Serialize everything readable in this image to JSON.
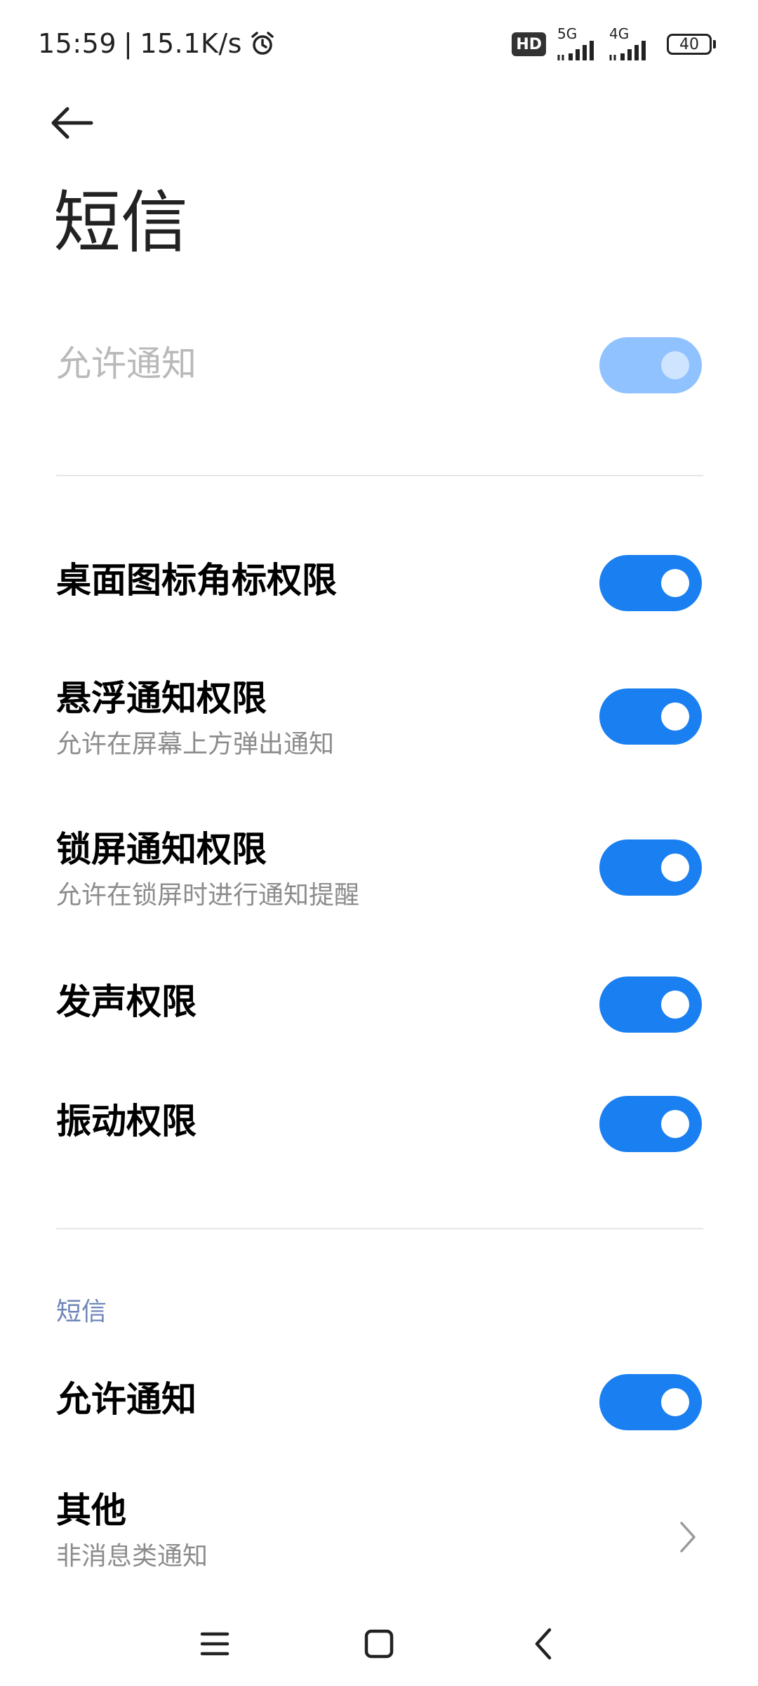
{
  "status_bar": {
    "time": "15:59",
    "separator": "|",
    "speed": "15.1K/s",
    "hd_label": "HD",
    "net1_label": "5G",
    "net2_label": "4G",
    "battery": "40",
    "icons": [
      "alarm-icon",
      "signal-5g-icon",
      "signal-4g-icon",
      "battery-icon"
    ]
  },
  "header": {
    "back_icon": "back-arrow-icon",
    "title": "短信"
  },
  "settings": {
    "allow_notifications_master": {
      "label": "允许通知",
      "enabled": false,
      "on": true
    },
    "items": [
      {
        "title": "桌面图标角标权限",
        "subtitle": "",
        "on": true
      },
      {
        "title": "悬浮通知权限",
        "subtitle": "允许在屏幕上方弹出通知",
        "on": true
      },
      {
        "title": "锁屏通知权限",
        "subtitle": "允许在锁屏时进行通知提醒",
        "on": true
      },
      {
        "title": "发声权限",
        "subtitle": "",
        "on": true
      },
      {
        "title": "振动权限",
        "subtitle": "",
        "on": true
      }
    ]
  },
  "channel_section": {
    "header": "短信",
    "allow": {
      "title": "允许通知",
      "on": true
    },
    "other": {
      "title": "其他",
      "subtitle": "非消息类通知"
    }
  },
  "nav_bar": {
    "icons": [
      "menu-icon",
      "home-icon",
      "back-icon"
    ]
  },
  "colors": {
    "accent": "#1a7ff0",
    "accent_disabled": "#90c2ff",
    "section_header": "#6f86b8",
    "divider": "#e6e6e6"
  }
}
